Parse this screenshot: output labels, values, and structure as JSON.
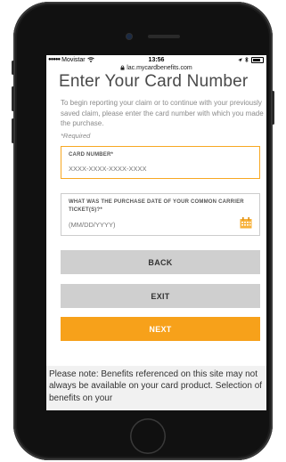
{
  "status_bar": {
    "carrier": "Movistar",
    "time": "13:56",
    "wifi_icon": "wifi-icon",
    "battery_icon": "battery-icon"
  },
  "browser": {
    "url": "lac.mycardbenefits.com"
  },
  "page": {
    "title": "Enter Your Card Number",
    "intro": "To begin reporting your claim or to continue with your previously saved claim, please enter the card number with which you made the purchase.",
    "required_note": "*Required"
  },
  "card_field": {
    "label": "CARD NUMBER*",
    "placeholder": "XXXX-XXXX-XXXX-XXXX"
  },
  "date_field": {
    "label": "WHAT WAS THE PURCHASE DATE OF YOUR COMMON CARRIER TICKET(S)?*",
    "placeholder": "(MM/DD/YYYY)",
    "icon": "calendar-icon"
  },
  "buttons": {
    "back": "BACK",
    "exit": "EXIT",
    "next": "NEXT"
  },
  "note": {
    "text": "Please note: Benefits referenced on this site may not always be available on your card product. Selection of benefits on your"
  },
  "colors": {
    "accent": "#f7a11a",
    "focus_border": "#f7a823",
    "grey_button": "#cfcfcf",
    "title_text": "#4a4a4a"
  }
}
